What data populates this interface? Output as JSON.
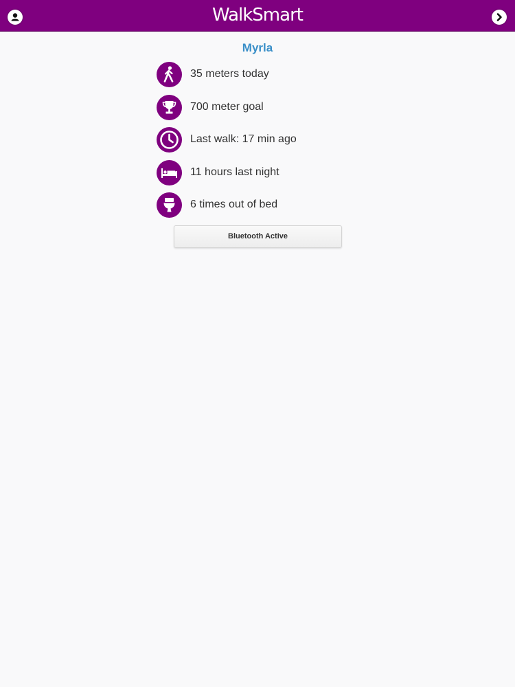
{
  "header": {
    "title": "WalkSmart",
    "left_icon": "user-icon",
    "right_icon": "chevron-right-icon"
  },
  "user": {
    "name": "Myrla"
  },
  "stats": [
    {
      "icon": "walking-person-icon",
      "text": "35 meters today"
    },
    {
      "icon": "trophy-icon",
      "text": "700 meter goal"
    },
    {
      "icon": "clock-icon",
      "text": "Last walk: 17 min ago"
    },
    {
      "icon": "bed-icon",
      "text": "11 hours last night"
    },
    {
      "icon": "toilet-icon",
      "text": "6 times out of bed"
    }
  ],
  "bluetooth": {
    "label": "Bluetooth Active"
  },
  "colors": {
    "header_bg": "#7f007f",
    "icon_bg": "#7f007f",
    "name_color": "#3a8fc8",
    "page_bg": "#f9f9fa"
  }
}
